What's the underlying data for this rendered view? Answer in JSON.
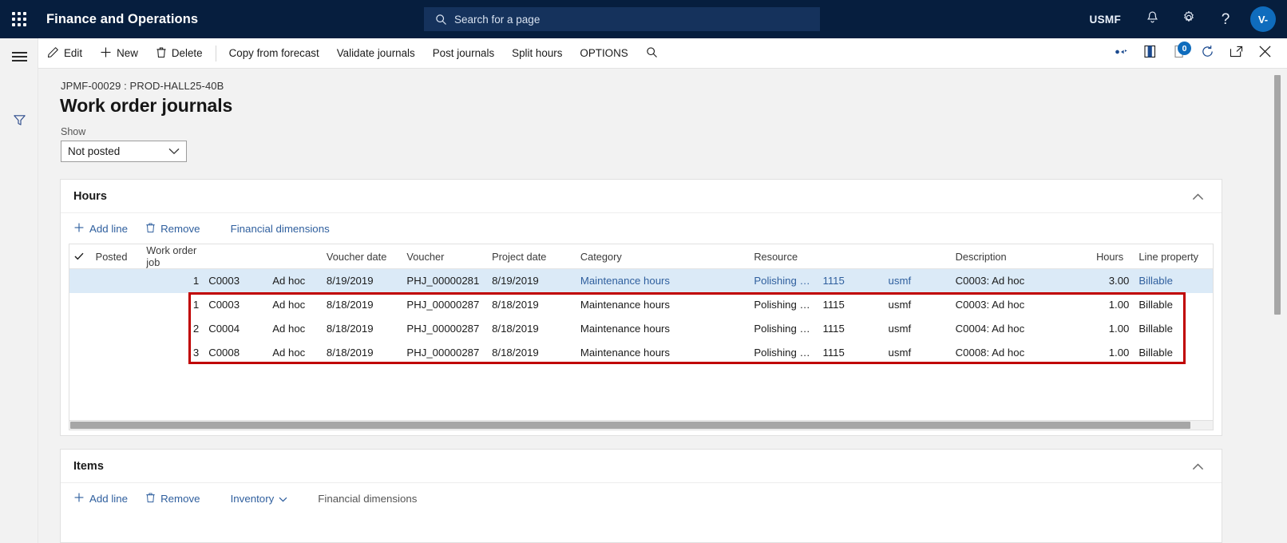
{
  "topbar": {
    "waffle_label": "app-launcher",
    "brand": "Finance and Operations",
    "search_placeholder": "Search for a page",
    "company": "USMF",
    "avatar_initials": "V-"
  },
  "command_bar": {
    "items": [
      {
        "label": "Edit",
        "icon": "pencil-icon"
      },
      {
        "label": "New",
        "icon": "plus-icon"
      },
      {
        "label": "Delete",
        "icon": "trash-icon"
      },
      {
        "label": "Copy from forecast",
        "icon": ""
      },
      {
        "label": "Validate journals",
        "icon": ""
      },
      {
        "label": "Post journals",
        "icon": ""
      },
      {
        "label": "Split hours",
        "icon": ""
      },
      {
        "label": "OPTIONS",
        "icon": ""
      }
    ],
    "search_icon": "search-icon",
    "right_icons": [
      {
        "name": "personalize-icon"
      },
      {
        "name": "office-attachment-icon"
      },
      {
        "name": "notes-icon",
        "badge": "0"
      },
      {
        "name": "refresh-icon"
      },
      {
        "name": "open-in-new-window-icon"
      },
      {
        "name": "close-icon"
      }
    ]
  },
  "page": {
    "breadcrumb": "JPMF-00029 : PROD-HALL25-40B",
    "title": "Work order journals",
    "show_label": "Show",
    "show_value": "Not posted"
  },
  "hours_section": {
    "title": "Hours",
    "collapse_icon": "chevron-up-icon",
    "actions": [
      {
        "label": "Add line",
        "icon": "plus-icon"
      },
      {
        "label": "Remove",
        "icon": "trash-icon"
      },
      {
        "label": "Financial dimensions",
        "icon": ""
      }
    ],
    "columns": [
      "Posted",
      "Work order job",
      "Voucher date",
      "Voucher",
      "Project date",
      "Category",
      "Resource",
      "Description",
      "Hours",
      "Line property"
    ],
    "rows": [
      {
        "selected": true,
        "posted": "",
        "line_no": "1",
        "job": "C0003",
        "job_type": "Ad hoc",
        "voucher_date": "8/19/2019",
        "voucher": "PHJ_00000281",
        "project_date": "8/19/2019",
        "category": "Maintenance hours",
        "resource": "Polishing w...",
        "resource_no": "1115",
        "legal_entity": "usmf",
        "description": "C0003: Ad hoc",
        "hours": "3.00",
        "line_property": "Billable"
      },
      {
        "selected": false,
        "posted": "",
        "line_no": "1",
        "job": "C0003",
        "job_type": "Ad hoc",
        "voucher_date": "8/18/2019",
        "voucher": "PHJ_00000287",
        "project_date": "8/18/2019",
        "category": "Maintenance hours",
        "resource": "Polishing w...",
        "resource_no": "1115",
        "legal_entity": "usmf",
        "description": "C0003: Ad hoc",
        "hours": "1.00",
        "line_property": "Billable"
      },
      {
        "selected": false,
        "posted": "",
        "line_no": "2",
        "job": "C0004",
        "job_type": "Ad hoc",
        "voucher_date": "8/18/2019",
        "voucher": "PHJ_00000287",
        "project_date": "8/18/2019",
        "category": "Maintenance hours",
        "resource": "Polishing w...",
        "resource_no": "1115",
        "legal_entity": "usmf",
        "description": "C0004: Ad hoc",
        "hours": "1.00",
        "line_property": "Billable"
      },
      {
        "selected": false,
        "posted": "",
        "line_no": "3",
        "job": "C0008",
        "job_type": "Ad hoc",
        "voucher_date": "8/18/2019",
        "voucher": "PHJ_00000287",
        "project_date": "8/18/2019",
        "category": "Maintenance hours",
        "resource": "Polishing w...",
        "resource_no": "1115",
        "legal_entity": "usmf",
        "description": "C0008: Ad hoc",
        "hours": "1.00",
        "line_property": "Billable"
      }
    ]
  },
  "items_section": {
    "title": "Items",
    "collapse_icon": "chevron-up-icon",
    "actions": [
      {
        "label": "Add line",
        "icon": "plus-icon"
      },
      {
        "label": "Remove",
        "icon": "trash-icon"
      },
      {
        "label": "Inventory",
        "icon": "chevron-down-icon"
      },
      {
        "label": "Financial dimensions",
        "icon": ""
      }
    ]
  },
  "annotation": {
    "color": "#c00000",
    "description": "red-highlight-box-around-rows-2-4"
  },
  "colors": {
    "nav_background": "#061e3e",
    "accent": "#0f6cbd",
    "link": "#2f5f9e",
    "selected_row": "#dbeaf7",
    "page_background": "#f2f2f2"
  }
}
